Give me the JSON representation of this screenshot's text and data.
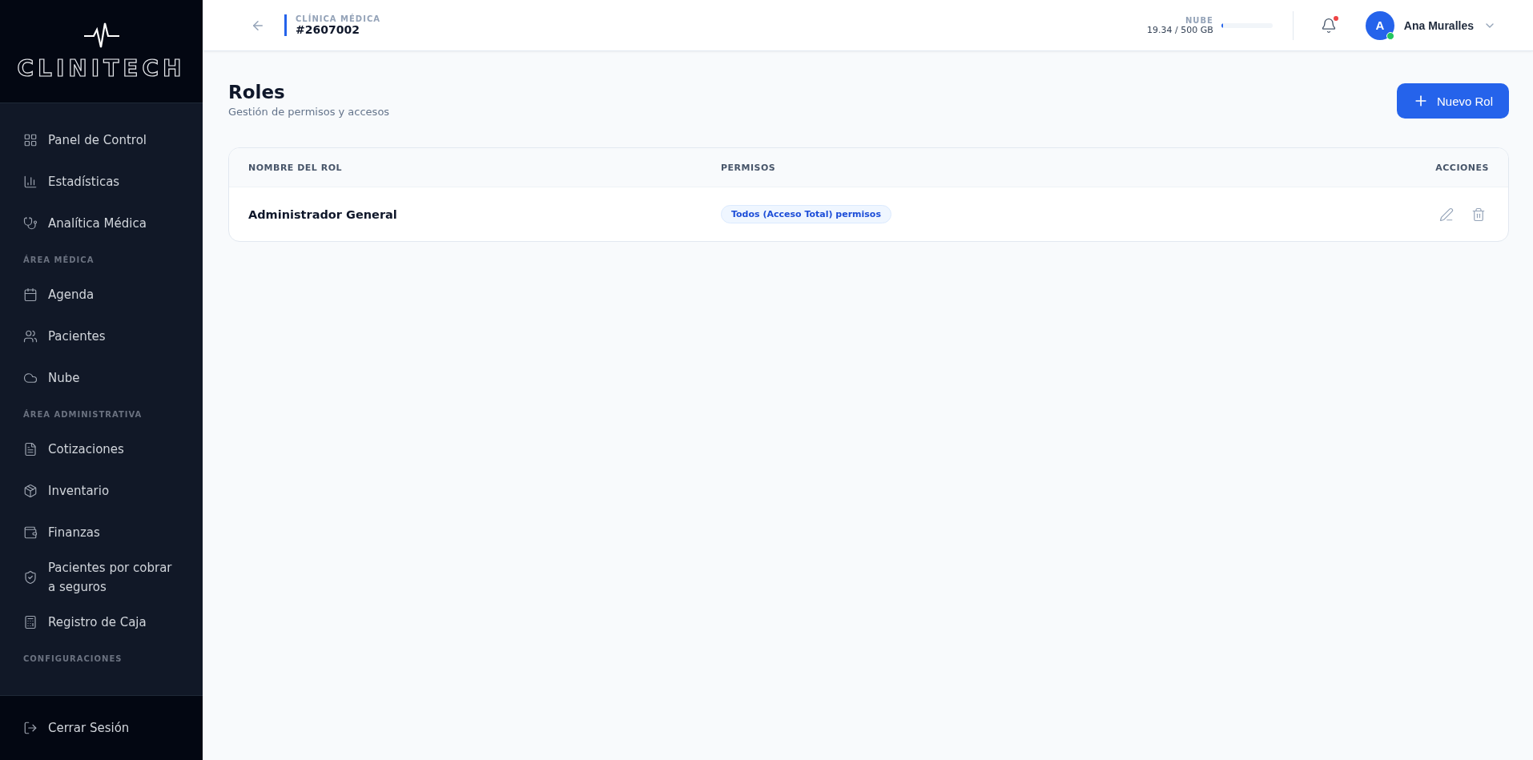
{
  "sidebar": {
    "logo": "CLINITECH",
    "groups": [
      {
        "items": [
          "Panel de Control",
          "Estadísticas",
          "Analítica Médica"
        ]
      },
      {
        "label": "ÁREA MÉDICA",
        "items": [
          "Agenda",
          "Pacientes",
          "Nube"
        ]
      },
      {
        "label": "ÁREA ADMINISTRATIVA",
        "items": [
          "Cotizaciones",
          "Inventario",
          "Finanzas",
          "Pacientes por cobrar a seguros",
          "Registro de Caja"
        ]
      },
      {
        "label": "CONFIGURACIONES"
      }
    ],
    "logout": "Cerrar Sesión"
  },
  "header": {
    "clinic_label": "CLÍNICA MÉDICA",
    "clinic_id": "#2607002",
    "storage": {
      "label": "NUBE",
      "reading": "19.34 / 500 GB",
      "level": 0.04
    },
    "notifications": {
      "unread": true
    },
    "user": {
      "initial": "A",
      "name": "Ana Muralles",
      "online": true
    }
  },
  "page": {
    "title": "Roles",
    "subtitle": "Gestión de permisos y accesos",
    "new_button": "Nuevo Rol"
  },
  "table": {
    "columns": [
      "NOMBRE DEL ROL",
      "PERMISOS",
      "ACCIONES"
    ],
    "rows": [
      {
        "name": "Administrador General",
        "permissions": "Todos (Acceso Total) permisos"
      }
    ]
  }
}
